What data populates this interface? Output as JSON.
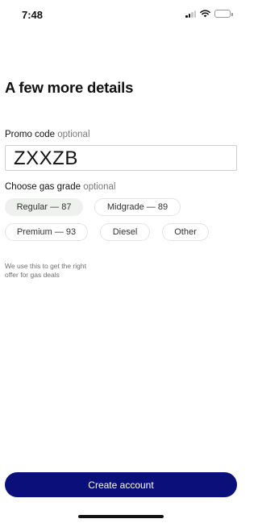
{
  "status_bar": {
    "time": "7:48",
    "icons": [
      "cellular-signal-icon",
      "wifi-icon",
      "battery-icon"
    ]
  },
  "page": {
    "title": "A few more details"
  },
  "promo": {
    "label": "Promo code",
    "optional": "optional",
    "value": "ZXXZB",
    "placeholder": ""
  },
  "gas_grade": {
    "label": "Choose gas grade",
    "optional": "optional",
    "options": [
      {
        "label": "Regular — 87",
        "selected": true
      },
      {
        "label": "Midgrade — 89",
        "selected": false
      },
      {
        "label": "Premium — 93",
        "selected": false
      },
      {
        "label": "Diesel",
        "selected": false
      },
      {
        "label": "Other",
        "selected": false
      }
    ],
    "helper": "We use this to get the right offer for gas deals"
  },
  "actions": {
    "create_account": "Create account"
  },
  "colors": {
    "primary_button": "#0b0f7a",
    "selected_chip": "#eef1ee",
    "optional_text": "#7a7a7a"
  }
}
